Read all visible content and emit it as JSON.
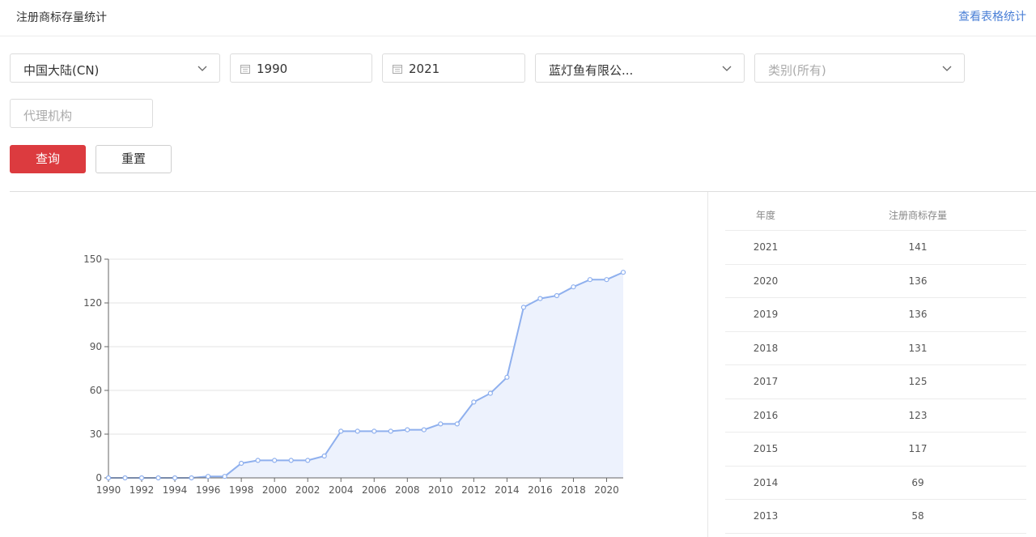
{
  "header": {
    "title": "注册商标存量统计",
    "view_table_link": "查看表格统计"
  },
  "filters": {
    "region": "中国大陆(CN)",
    "start_year": "1990",
    "end_year": "2021",
    "applicant": "蓝灯鱼有限公...",
    "category_placeholder": "类别(所有)",
    "agency_placeholder": "代理机构"
  },
  "buttons": {
    "query": "查询",
    "reset": "重置"
  },
  "table": {
    "headers": [
      "年度",
      "注册商标存量"
    ],
    "rows": [
      [
        "2021",
        "141"
      ],
      [
        "2020",
        "136"
      ],
      [
        "2019",
        "136"
      ],
      [
        "2018",
        "131"
      ],
      [
        "2017",
        "125"
      ],
      [
        "2016",
        "123"
      ],
      [
        "2015",
        "117"
      ],
      [
        "2014",
        "69"
      ],
      [
        "2013",
        "58"
      ]
    ]
  },
  "colors": {
    "accent_red": "#dc3b3f",
    "link_blue": "#4a7fd6",
    "line_blue": "#8fb0ee",
    "area_fill": "#edf2fd"
  },
  "chart_data": {
    "type": "area",
    "x": [
      1990,
      1991,
      1992,
      1993,
      1994,
      1995,
      1996,
      1997,
      1998,
      1999,
      2000,
      2001,
      2002,
      2003,
      2004,
      2005,
      2006,
      2007,
      2008,
      2009,
      2010,
      2011,
      2012,
      2013,
      2014,
      2015,
      2016,
      2017,
      2018,
      2019,
      2020,
      2021
    ],
    "values": [
      0,
      0,
      0,
      0,
      0,
      0,
      1,
      1,
      10,
      12,
      12,
      12,
      12,
      15,
      32,
      32,
      32,
      32,
      33,
      33,
      37,
      37,
      52,
      58,
      69,
      117,
      123,
      125,
      131,
      136,
      136,
      141
    ],
    "x_ticks": [
      "1990",
      "1992",
      "1994",
      "1996",
      "1998",
      "2000",
      "2002",
      "2004",
      "2006",
      "2008",
      "2010",
      "2012",
      "2014",
      "2016",
      "2018",
      "2020"
    ],
    "y_ticks": [
      "0",
      "30",
      "60",
      "90",
      "120",
      "150"
    ],
    "xlim": [
      1990,
      2021
    ],
    "ylim": [
      0,
      150
    ],
    "grid": true,
    "legend": "none",
    "title": "",
    "xlabel": "",
    "ylabel": ""
  }
}
